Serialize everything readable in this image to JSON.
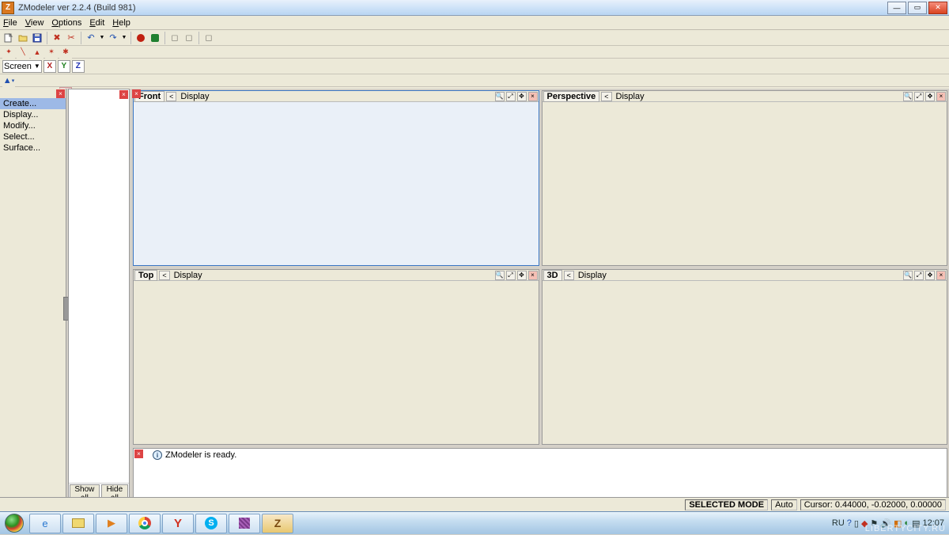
{
  "titlebar": {
    "title": "ZModeler ver 2.2.4 (Build 981)"
  },
  "menubar": [
    "File",
    "View",
    "Options",
    "Edit",
    "Help"
  ],
  "coord_selector": {
    "label": "Screen"
  },
  "axes": [
    "X",
    "Y",
    "Z"
  ],
  "sidebar": {
    "items": [
      {
        "label": "Create...",
        "active": true
      },
      {
        "label": "Display...",
        "active": false
      },
      {
        "label": "Modify...",
        "active": false
      },
      {
        "label": "Select...",
        "active": false
      },
      {
        "label": "Surface...",
        "active": false
      }
    ]
  },
  "tree_footer": {
    "show": "Show all",
    "hide": "Hide all"
  },
  "viewports": [
    {
      "title": "Front",
      "display": "Display",
      "active": true
    },
    {
      "title": "Perspective",
      "display": "Display",
      "active": false
    },
    {
      "title": "Top",
      "display": "Display",
      "active": false
    },
    {
      "title": "3D",
      "display": "Display",
      "active": false
    }
  ],
  "log": {
    "message": "ZModeler is ready."
  },
  "statusbar": {
    "mode": "SELECTED MODE",
    "auto": "Auto",
    "cursor": "Cursor: 0.44000, -0.02000, 0.00000"
  },
  "tray": {
    "lang": "RU",
    "time": "12:07"
  },
  "watermark": "LIBERTYCITY.RU"
}
